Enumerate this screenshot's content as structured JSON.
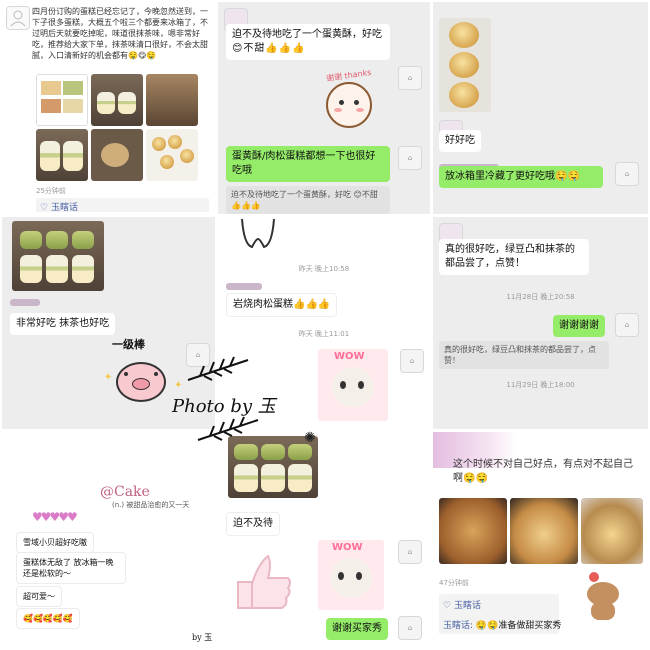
{
  "panel1": {
    "post_text": "四月份订购的蛋糕已经忘记了，今晚忽然送到，一下子很多蛋糕，大概五个啦三个都要来冰箱了，不过明后天就要吃掉呢，味道很抹茶味，嗯非常好吃，推荐给大家下单，抹茶味清口很好，不会太甜腻，入口清新好的机会都有🤤😋🤤",
    "time": "25分钟前",
    "like_name": "玉瞎话"
  },
  "panel2": {
    "msg1": "迫不及待地吃了一个蛋黄酥，好吃",
    "msg1_emoji": "😊不甜👍👍👍",
    "sticker_text": "谢谢 thanks",
    "msg2": "蛋黄酥/肉松蛋糕都想一下也很好吃哦",
    "quote": "迫不及待地吃了一个蛋黄酥，好吃 😊不甜👍👍👍"
  },
  "panel3": {
    "msg1": "好好吃",
    "msg2": "放冰箱里冷藏了更好吃哦🤤🤤"
  },
  "panel4": {
    "msg1": "非常好吃 抹茶也好吃"
  },
  "panel5": {
    "time1": "昨天 晚上10:58",
    "msg1": "岩烧肉松蛋糕👍👍👍",
    "time2": "昨天 晚上11:01",
    "sticker_text": "WOW"
  },
  "panel6": {
    "msg1": "真的很好吃，绿豆凸和抹茶的都品尝了，点赞！",
    "time1": "11月28日 晚上20:58",
    "msg2": "谢谢谢谢",
    "quote": "真的很好吃，绿豆凸和抹茶的都品尝了，点赞！",
    "time2": "11月29日 晚上18:00"
  },
  "panel7": {
    "title": "@Cake",
    "subtitle": "(n.) 被甜品治愈的又一天",
    "comments": [
      "雪域小贝超好吃嗷",
      "蛋糕体无敌了 放冰箱一晚还是松软的～",
      "超可爱～",
      "🥰🥰🥰🥰🥰"
    ],
    "signature": "by 玉"
  },
  "panel8": {
    "msg1": "迫不及待",
    "sticker_text": "WOW",
    "msg2": "谢谢买家秀"
  },
  "panel9": {
    "caption": "这个时候不对自己好点，有点对不起自己啊🤤🤤",
    "time": "47分钟前",
    "like_name": "玉瞎话",
    "comment_name": "玉瞎话:",
    "comment_text": "🤤🤤准备做甜买家秀"
  },
  "overlay": {
    "badge_text": "一级棒",
    "photo_by": "Photo by 玉"
  }
}
